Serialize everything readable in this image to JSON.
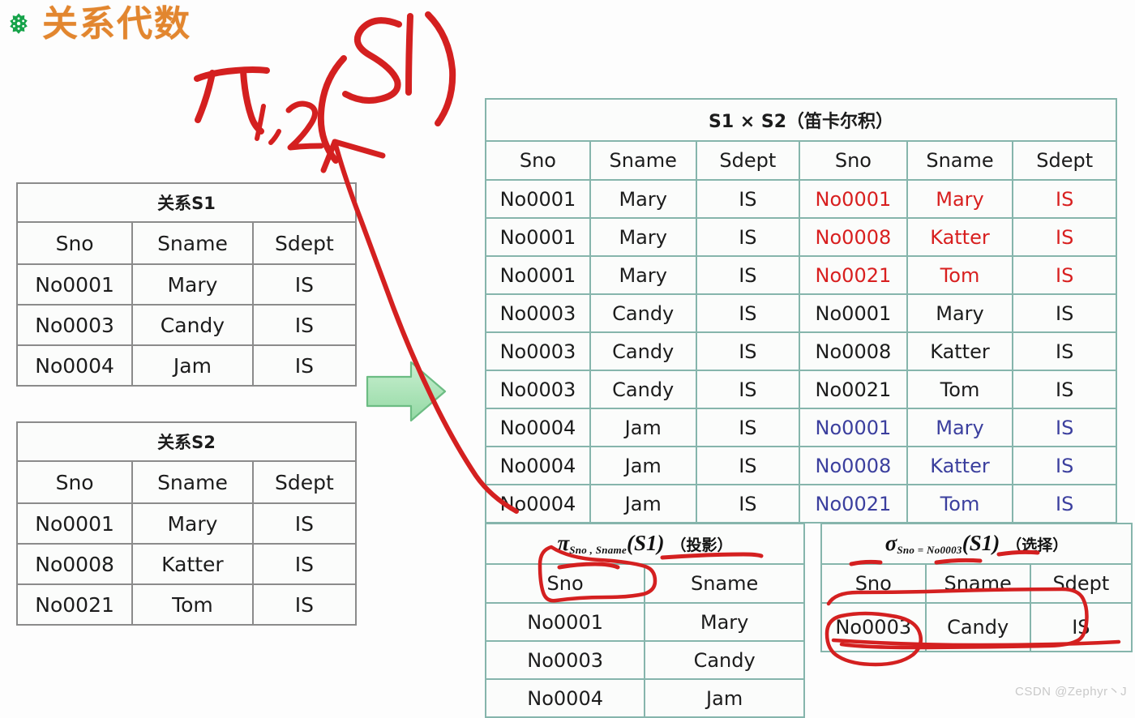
{
  "page": {
    "title": "关系代数",
    "bullet_icon": "green-flower-bullet-icon",
    "background_color": "#fdfdfd",
    "watermark": "CSDN @Zephyr丶J"
  },
  "annotations": {
    "handwritten_formula": "π1,2(S1)",
    "handwritten_color": "#d42020",
    "arrow_icon": "green-right-arrow",
    "arrow_color": "#a9e3b4",
    "down_arrow_icon": "red-hand-drawn-arrow"
  },
  "tables": {
    "s1": {
      "caption": "关系S1",
      "headers": [
        "Sno",
        "Sname",
        "Sdept"
      ],
      "rows": [
        [
          "No0001",
          "Mary",
          "IS"
        ],
        [
          "No0003",
          "Candy",
          "IS"
        ],
        [
          "No0004",
          "Jam",
          "IS"
        ]
      ]
    },
    "s2": {
      "caption": "关系S2",
      "headers": [
        "Sno",
        "Sname",
        "Sdept"
      ],
      "rows": [
        [
          "No0001",
          "Mary",
          "IS"
        ],
        [
          "No0008",
          "Katter",
          "IS"
        ],
        [
          "No0021",
          "Tom",
          "IS"
        ]
      ]
    },
    "product": {
      "caption": "S1 × S2（笛卡尔积）",
      "headers": [
        "Sno",
        "Sname",
        "Sdept",
        "Sno",
        "Sname",
        "Sdept"
      ],
      "rows": [
        {
          "cells": [
            "No0001",
            "Mary",
            "IS",
            "No0001",
            "Mary",
            "IS"
          ],
          "right_color": "red"
        },
        {
          "cells": [
            "No0001",
            "Mary",
            "IS",
            "No0008",
            "Katter",
            "IS"
          ],
          "right_color": "red"
        },
        {
          "cells": [
            "No0001",
            "Mary",
            "IS",
            "No0021",
            "Tom",
            "IS"
          ],
          "right_color": "red"
        },
        {
          "cells": [
            "No0003",
            "Candy",
            "IS",
            "No0001",
            "Mary",
            "IS"
          ],
          "right_color": "black"
        },
        {
          "cells": [
            "No0003",
            "Candy",
            "IS",
            "No0008",
            "Katter",
            "IS"
          ],
          "right_color": "black"
        },
        {
          "cells": [
            "No0003",
            "Candy",
            "IS",
            "No0021",
            "Tom",
            "IS"
          ],
          "right_color": "black"
        },
        {
          "cells": [
            "No0004",
            "Jam",
            "IS",
            "No0001",
            "Mary",
            "IS"
          ],
          "right_color": "blue"
        },
        {
          "cells": [
            "No0004",
            "Jam",
            "IS",
            "No0008",
            "Katter",
            "IS"
          ],
          "right_color": "blue"
        },
        {
          "cells": [
            "No0004",
            "Jam",
            "IS",
            "No0021",
            "Tom",
            "IS"
          ],
          "right_color": "blue"
        }
      ]
    },
    "projection": {
      "caption_op": "π",
      "caption_sub": "Sno , Sname",
      "caption_arg": "(S1)",
      "caption_cn": "（投影）",
      "headers": [
        "Sno",
        "Sname"
      ],
      "rows": [
        [
          "No0001",
          "Mary"
        ],
        [
          "No0003",
          "Candy"
        ],
        [
          "No0004",
          "Jam"
        ]
      ]
    },
    "selection": {
      "caption_op": "σ",
      "caption_sub": "Sno = No0003",
      "caption_arg": "(S1)",
      "caption_cn": "（选择）",
      "headers": [
        "Sno",
        "Sname",
        "Sdept"
      ],
      "rows": [
        [
          "No0003",
          "Candy",
          "IS"
        ]
      ]
    }
  },
  "colors": {
    "title": "#e2862f",
    "grey_border": "#8b8b8b",
    "teal_border": "#86b5ac",
    "red_text": "#d81f1f",
    "blue_text": "#3b3f9e",
    "ink_red": "#d42020"
  }
}
